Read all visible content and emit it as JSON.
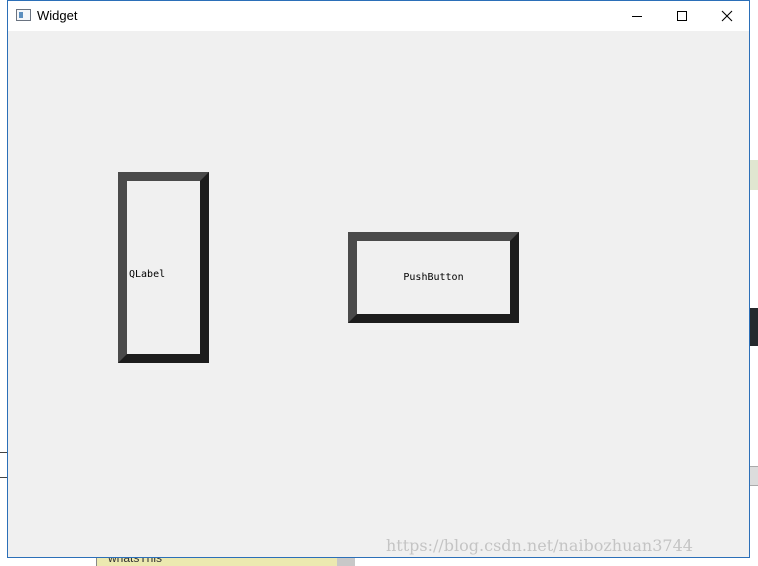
{
  "window": {
    "title": "Widget",
    "icon": "app-window-icon",
    "controls": {
      "minimize_icon": "minimize-icon",
      "maximize_icon": "maximize-icon",
      "close_icon": "close-icon"
    }
  },
  "content": {
    "label_text": "QLabel",
    "button_text": "PushButton"
  },
  "background": {
    "partial_text": "whatsThis"
  },
  "watermark": {
    "text": "https://blog.csdn.net/naibozhuan3744"
  },
  "colors": {
    "window_bg": "#f0f0f0",
    "titlebar_bg": "#ffffff",
    "frame_border": "#2b6fb8",
    "widget_border_dark": "#1c1c1c",
    "widget_border_light": "#4a4a4a",
    "watermark": "#c4c4c4"
  }
}
